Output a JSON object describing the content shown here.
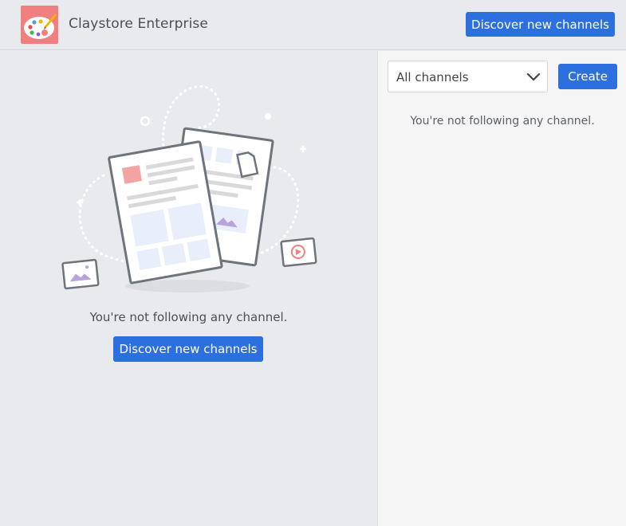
{
  "app": {
    "name": "Claystore Enterprise",
    "logo_icon": "paint-palette-icon",
    "colors": {
      "accent": "#2c6fdf",
      "logo_bg": "#f08080",
      "background": "#e9eaee",
      "panel": "#f5f5f6"
    }
  },
  "header": {
    "discover_label": "Discover new channels"
  },
  "main": {
    "illustration_icon": "documents-illustration",
    "empty_message": "You're not following any channel.",
    "discover_label": "Discover new channels"
  },
  "sidebar": {
    "filter": {
      "selected": "All channels",
      "icon": "chevron-down-icon"
    },
    "create_label": "Create",
    "empty_message": "You're not following any channel."
  }
}
